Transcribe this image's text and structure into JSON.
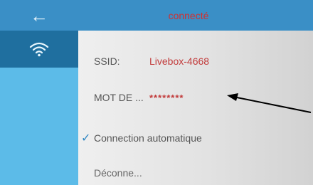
{
  "header": {
    "back_icon": "left-arrow-icon",
    "title": "connecté"
  },
  "sidebar": {
    "items": [
      {
        "icon": "wifi-icon",
        "selected": true
      }
    ]
  },
  "details": {
    "ssid_label": "SSID:",
    "ssid_value": "Livebox-4668",
    "password_label": "MOT DE ...",
    "password_value": "********",
    "auto_connect_label": "Connection automatique",
    "auto_connect_checked": true,
    "disconnect_label": "Déconne..."
  },
  "colors": {
    "header": "#3a8fc6",
    "sidebar": "#5cbbe8",
    "sidebar_selected": "#1f6f9f",
    "value_text": "#c23b3b",
    "check": "#2f87c3"
  }
}
